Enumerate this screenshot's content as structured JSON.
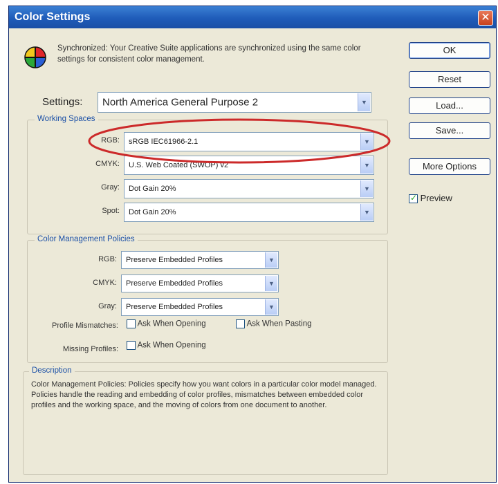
{
  "window": {
    "title": "Color Settings",
    "close_glyph": "✕"
  },
  "sync": {
    "icon": "color-wheel-icon",
    "text": "Synchronized: Your Creative Suite applications are synchronized using the same color settings for consistent color management."
  },
  "settings": {
    "label": "Settings:",
    "value": "North America General Purpose 2"
  },
  "working_spaces": {
    "legend": "Working Spaces",
    "rgb": {
      "label": "RGB:",
      "value": "sRGB IEC61966-2.1"
    },
    "cmyk": {
      "label": "CMYK:",
      "value": "U.S. Web Coated (SWOP) v2"
    },
    "gray": {
      "label": "Gray:",
      "value": "Dot Gain 20%"
    },
    "spot": {
      "label": "Spot:",
      "value": "Dot Gain 20%"
    }
  },
  "policies": {
    "legend": "Color Management Policies",
    "rgb": {
      "label": "RGB:",
      "value": "Preserve Embedded Profiles"
    },
    "cmyk": {
      "label": "CMYK:",
      "value": "Preserve Embedded Profiles"
    },
    "gray": {
      "label": "Gray:",
      "value": "Preserve Embedded Profiles"
    },
    "profile_mismatches": {
      "label": "Profile Mismatches:",
      "ask_opening": "Ask When Opening",
      "ask_pasting": "Ask When Pasting"
    },
    "missing_profiles": {
      "label": "Missing Profiles:",
      "ask_opening": "Ask When Opening"
    }
  },
  "description": {
    "legend": "Description",
    "text": "Color Management Policies: Policies specify how you want colors in a particular color model managed. Policies handle the reading and embedding of color profiles, mismatches between embedded color profiles and the working space, and the moving of colors from one document to another."
  },
  "buttons": {
    "ok": "OK",
    "reset": "Reset",
    "load": "Load...",
    "save": "Save...",
    "more_options": "More Options"
  },
  "preview": {
    "label": "Preview",
    "checked": true
  },
  "colors": {
    "title_bar": "#1f5cb9",
    "highlight_oval": "#cc2a2a",
    "dialog_bg": "#ece9d8"
  }
}
